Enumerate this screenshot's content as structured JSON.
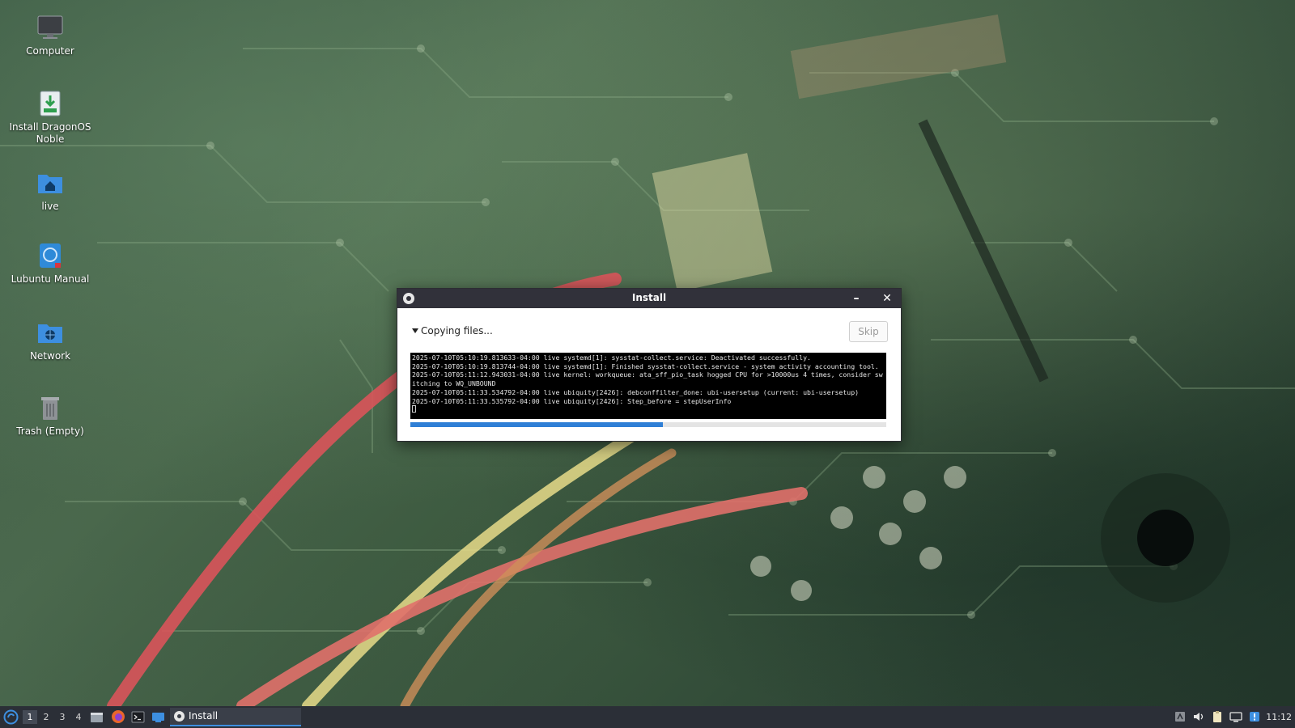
{
  "desktop": {
    "icons": [
      {
        "label": "Computer",
        "icon": "computer-icon"
      },
      {
        "label": "Install DragonOS Noble",
        "icon": "installer-icon"
      },
      {
        "label": "live",
        "icon": "home-folder-icon"
      },
      {
        "label": "Lubuntu Manual",
        "icon": "manual-icon"
      },
      {
        "label": "Network",
        "icon": "network-folder-icon"
      },
      {
        "label": "Trash (Empty)",
        "icon": "trash-icon"
      }
    ]
  },
  "window": {
    "title": "Install",
    "status": "Copying files...",
    "skip_label": "Skip",
    "progress": 0.53,
    "log_lines": [
      "2025-07-10T05:10:19.813633-04:00 live systemd[1]: sysstat-collect.service: Deactivated successfully.",
      "2025-07-10T05:10:19.813744-04:00 live systemd[1]: Finished sysstat-collect.service - system activity accounting tool.",
      "2025-07-10T05:11:12.943031-04:00 live kernel: workqueue: ata_sff_pio_task hogged CPU for >10000us 4 times, consider switching to WQ_UNBOUND",
      "2025-07-10T05:11:33.534792-04:00 live ubiquity[2426]: debconffilter_done: ubi-usersetup (current: ubi-usersetup)",
      "2025-07-10T05:11:33.535792-04:00 live ubiquity[2426]: Step_before = stepUserInfo"
    ]
  },
  "taskbar": {
    "workspaces": [
      "1",
      "2",
      "3",
      "4"
    ],
    "active_workspace": "1",
    "task_label": "Install",
    "clock": "11:12"
  },
  "colors": {
    "titlebar": "#31313a",
    "progress": "#2f7fd6",
    "taskbar": "#2b2f37"
  }
}
